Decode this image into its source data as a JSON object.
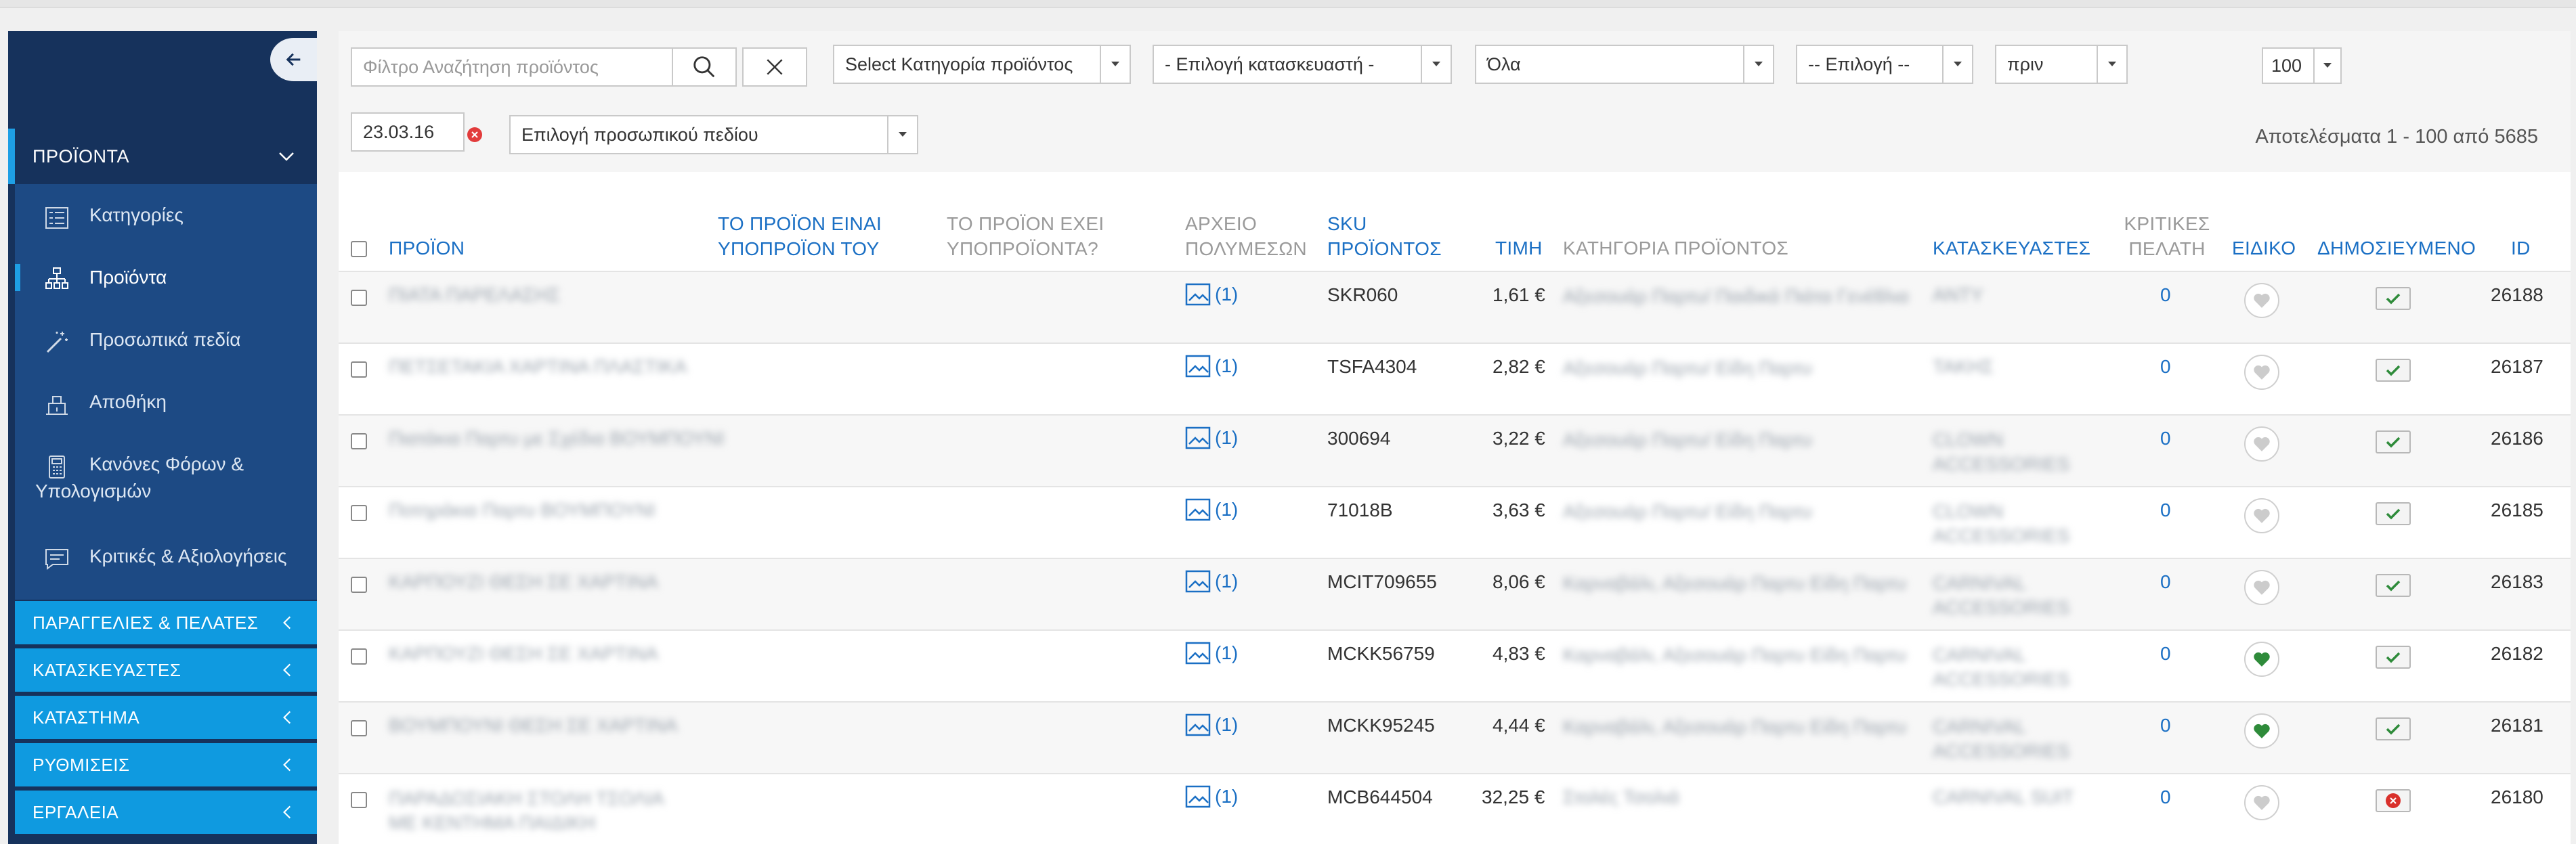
{
  "sidebar": {
    "section_title": "ΠΡΟΪΟΝΤΑ",
    "items": [
      {
        "label": "Κατηγορίες",
        "icon": "categories-list-icon"
      },
      {
        "label": "Προϊόντα",
        "icon": "products-tree-icon"
      },
      {
        "label": "Προσωπικά πεδία",
        "icon": "magic-wand-icon"
      },
      {
        "label": "Αποθήκη",
        "icon": "warehouse-icon"
      },
      {
        "label": "Κανόνες Φόρων & Υπολογισμών",
        "icon": "calculator-icon"
      },
      {
        "label": "Κριτικές & Αξιολογήσεις",
        "icon": "chat-bubble-icon"
      }
    ],
    "groups": [
      "ΠΑΡΑΓΓΕΛΙΕΣ & ΠΕΛΑΤΕΣ",
      "ΚΑΤΑΣΚΕΥΑΣΤΕΣ",
      "ΚΑΤΑΣΤΗΜΑ",
      "ΡΥΘΜΙΣΕΙΣ",
      "ΕΡΓΑΛΕΙΑ"
    ]
  },
  "filters": {
    "search_placeholder": "Φίλτρο Αναζήτηση προϊόντος",
    "category": "Select Κατηγορία προϊόντος",
    "manufacturer": "- Επιλογή κατασκευαστή -",
    "status": "Όλα",
    "option": "-- Επιλογή --",
    "when": "πριν",
    "per_page": "100",
    "date": "23.03.16",
    "custom_field": "Επιλογή προσωπικού πεδίου",
    "results": "Αποτελέσματα 1 - 100 από 5685"
  },
  "table": {
    "headers": {
      "product": "ΠΡΟΪΟΝ",
      "is_subproduct": "ΤΟ ΠΡΟΪΟΝ ΕΙΝΑΙ ΥΠΟΠΡΟΪΟΝ ΤΟΥ",
      "has_subproducts": "ΤΟ ΠΡΟΪΟΝ ΕΧΕΙ ΥΠΟΠΡΟΪΟΝΤΑ?",
      "media": "ΑΡΧΕΙΟ ΠΟΛΥΜΕΣΩΝ",
      "sku": "SKU ΠΡΟΪΟΝΤΟΣ",
      "price": "ΤΙΜΗ",
      "category": "ΚΑΤΗΓΟΡΙΑ ΠΡΟΪΟΝΤΟΣ",
      "manufacturers": "ΚΑΤΑΣΚΕΥΑΣΤΕΣ",
      "reviews": "ΚΡΙΤΙΚΕΣ ΠΕΛΑΤΗ",
      "special": "ΕΙΔΙΚΟ",
      "published": "ΔΗΜΟΣΙΕΥΜΕΝΟ",
      "id": "ID"
    },
    "rows": [
      {
        "product": "ΠΙΑΤΑ ΠΑΡΕΛΑΣΗΣ",
        "media": "(1)",
        "sku": "SKR060",
        "price": "1,61 €",
        "category": "Αξεσουάρ Παρτυ/ Παιδικά Πιάτα Γενέθλια",
        "manufacturer": "ΑΝΤΥ",
        "reviews": "0",
        "special": false,
        "published": true,
        "id": "26188"
      },
      {
        "product": "ΠΕΤΣΕΤΑΚΙΑ ΧΑΡΤΙΝΑ ΠΛΑΣΤΙΚΑ",
        "media": "(1)",
        "sku": "TSFA4304",
        "price": "2,82 €",
        "category": "Αξεσουάρ Παρτυ/ Είδη Παρτυ",
        "manufacturer": "ΤΑΚΗΣ",
        "reviews": "0",
        "special": false,
        "published": true,
        "id": "26187"
      },
      {
        "product": "Πιατάκια Παρτυ με Σχέδια ΒΟΥΜΠΟΥΝΙ",
        "media": "(1)",
        "sku": "300694",
        "price": "3,22 €",
        "category": "Αξεσουάρ Παρτυ/ Είδη Παρτυ",
        "manufacturer": "CLOWN ACCESSORIES",
        "reviews": "0",
        "special": false,
        "published": true,
        "id": "26186"
      },
      {
        "product": "Ποτηράκια Παρτυ ΒΟΥΜΠΟΥΝΙ",
        "media": "(1)",
        "sku": "71018B",
        "price": "3,63 €",
        "category": "Αξεσουάρ Παρτυ/ Είδη Παρτυ",
        "manufacturer": "CLOWN ACCESSORIES",
        "reviews": "0",
        "special": false,
        "published": true,
        "id": "26185"
      },
      {
        "product": "ΚΑΡΠΟΥΖΙ ΘΕΣΗ ΣΕ ΧΑΡΤΙΝΑ",
        "media": "(1)",
        "sku": "MCIT709655",
        "price": "8,06 €",
        "category": "Καρναβάλι, Αξεσουάρ Παρτυ Είδη Παρτυ",
        "manufacturer": "CARNIVAL ACCESSORIES",
        "reviews": "0",
        "special": false,
        "published": true,
        "id": "26183"
      },
      {
        "product": "ΚΑΡΠΟΥΖΙ ΘΕΣΗ ΣΕ ΧΑΡΤΙΝΑ",
        "media": "(1)",
        "sku": "MCKK56759",
        "price": "4,83 €",
        "category": "Καρναβάλι, Αξεσουάρ Παρτυ Είδη Παρτυ",
        "manufacturer": "CARNIVAL ACCESSORIES",
        "reviews": "0",
        "special": true,
        "published": true,
        "id": "26182"
      },
      {
        "product": "ΒΟΥΜΠΟΥΝΙ ΘΕΣΗ ΣΕ ΧΑΡΤΙΝΑ",
        "media": "(1)",
        "sku": "MCKK95245",
        "price": "4,44 €",
        "category": "Καρναβάλι, Αξεσουάρ Παρτυ Είδη Παρτυ",
        "manufacturer": "CARNIVAL ACCESSORIES",
        "reviews": "0",
        "special": true,
        "published": true,
        "id": "26181"
      },
      {
        "product": "ΠΑΡΑΔΟΣΙΑΚΗ ΣΤΟΛΗ ΤΣΟΛΙΑ ΜΕ ΚΕΝΤΗΜΑ ΠΑΙΔΙΚΗ",
        "media": "(1)",
        "sku": "MCB644504",
        "price": "32,25 €",
        "category": "Στολές Τσολιά",
        "manufacturer": "CARNIVAL SUIT",
        "reviews": "0",
        "special": false,
        "published": false,
        "id": "26180"
      }
    ]
  },
  "colors": {
    "sidebar_dark": "#16325c",
    "sidebar_sub": "#1d4a84",
    "sidebar_group": "#0f9ae0",
    "accent_link": "#1a6fc4",
    "published_check": "#2e8b3a",
    "unpublished_x": "#d9302b",
    "special_heart": "#2e8b3a"
  }
}
